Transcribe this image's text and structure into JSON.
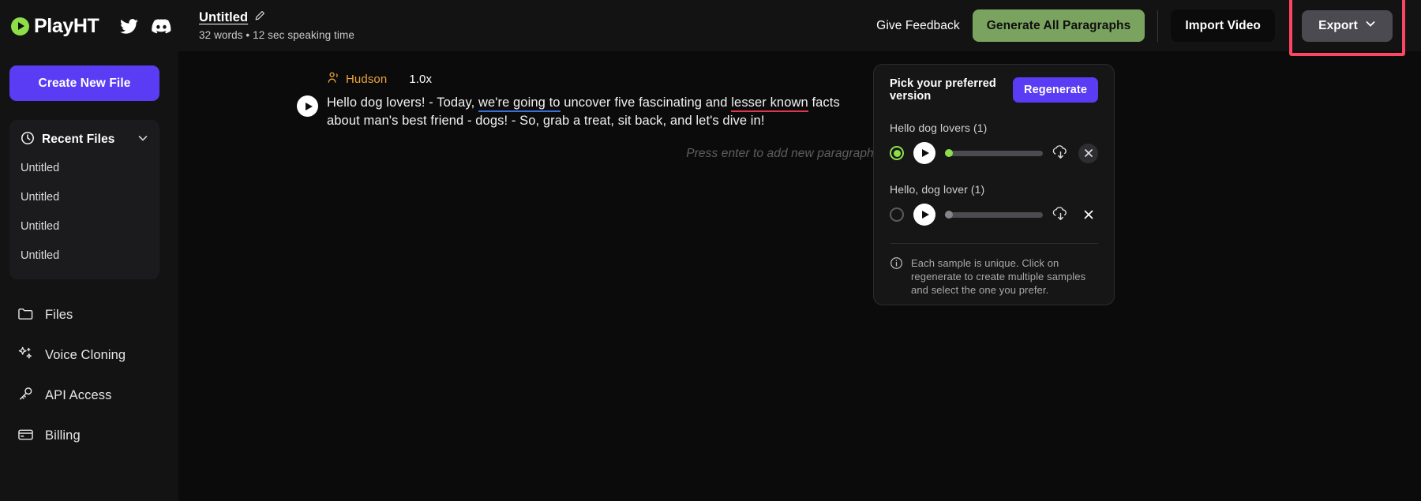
{
  "brand": {
    "name": "PlayHT",
    "logo_icon": "play-circle-logo",
    "accent": "#8ede4a",
    "social": [
      {
        "icon": "twitter-icon",
        "name": "twitter"
      },
      {
        "icon": "discord-icon",
        "name": "discord"
      }
    ]
  },
  "sidebar": {
    "create_button": "Create New File",
    "recent": {
      "icon": "clock-icon",
      "title": "Recent Files",
      "chevron": "chevron-down-icon",
      "items": [
        "Untitled",
        "Untitled",
        "Untitled",
        "Untitled"
      ]
    },
    "nav": [
      {
        "label": "Files",
        "icon": "folder-icon"
      },
      {
        "label": "Voice Cloning",
        "icon": "sparkles-icon"
      },
      {
        "label": "API Access",
        "icon": "key-icon"
      },
      {
        "label": "Billing",
        "icon": "credit-card-icon"
      }
    ]
  },
  "topbar": {
    "doc_title": "Untitled",
    "edit_icon": "pencil-edit-icon",
    "doc_meta": "32 words • 12 sec speaking time",
    "feedback": "Give Feedback",
    "generate_all": "Generate All Paragraphs",
    "import_video": "Import Video",
    "export": "Export",
    "export_chevron": "chevron-down-icon",
    "highlight_color": "#fb4563",
    "generate_color": "#7aa35f"
  },
  "editor": {
    "voice_name": "Hudson",
    "voice_icon": "speaker-person-icon",
    "speed": "1.0x",
    "play_icon": "play-icon",
    "paragraph": {
      "seg1": "Hello dog lovers! - Today, ",
      "seg2_underline_blue": "we're going to",
      "seg3": " uncover five fascinating and ",
      "seg4_underline_red": "lesser known",
      "seg5": " facts about man's best friend - dogs! - So, grab a treat, sit back, and let's dive in!"
    },
    "underline_blue_color": "#3b6fd4",
    "underline_red_color": "#e0344f",
    "record_dot_color": "#e22b45",
    "add_paragraph_hint": "Press enter to add new paragraphs",
    "add_paragraph_close": "×"
  },
  "version_panel": {
    "title": "Pick your preferred version",
    "regenerate": "Regenerate",
    "samples": [
      {
        "label": "Hello dog lovers (1)",
        "selected": true,
        "play_icon": "play-icon",
        "download_icon": "download-icon",
        "remove_icon": "close-icon"
      },
      {
        "label": "Hello, dog lover (1)",
        "selected": false,
        "play_icon": "play-icon",
        "download_icon": "download-icon",
        "remove_icon": "close-icon"
      }
    ],
    "note_icon": "info-icon",
    "note": "Each sample is unique. Click on regenerate to create multiple samples and select the one you prefer."
  }
}
